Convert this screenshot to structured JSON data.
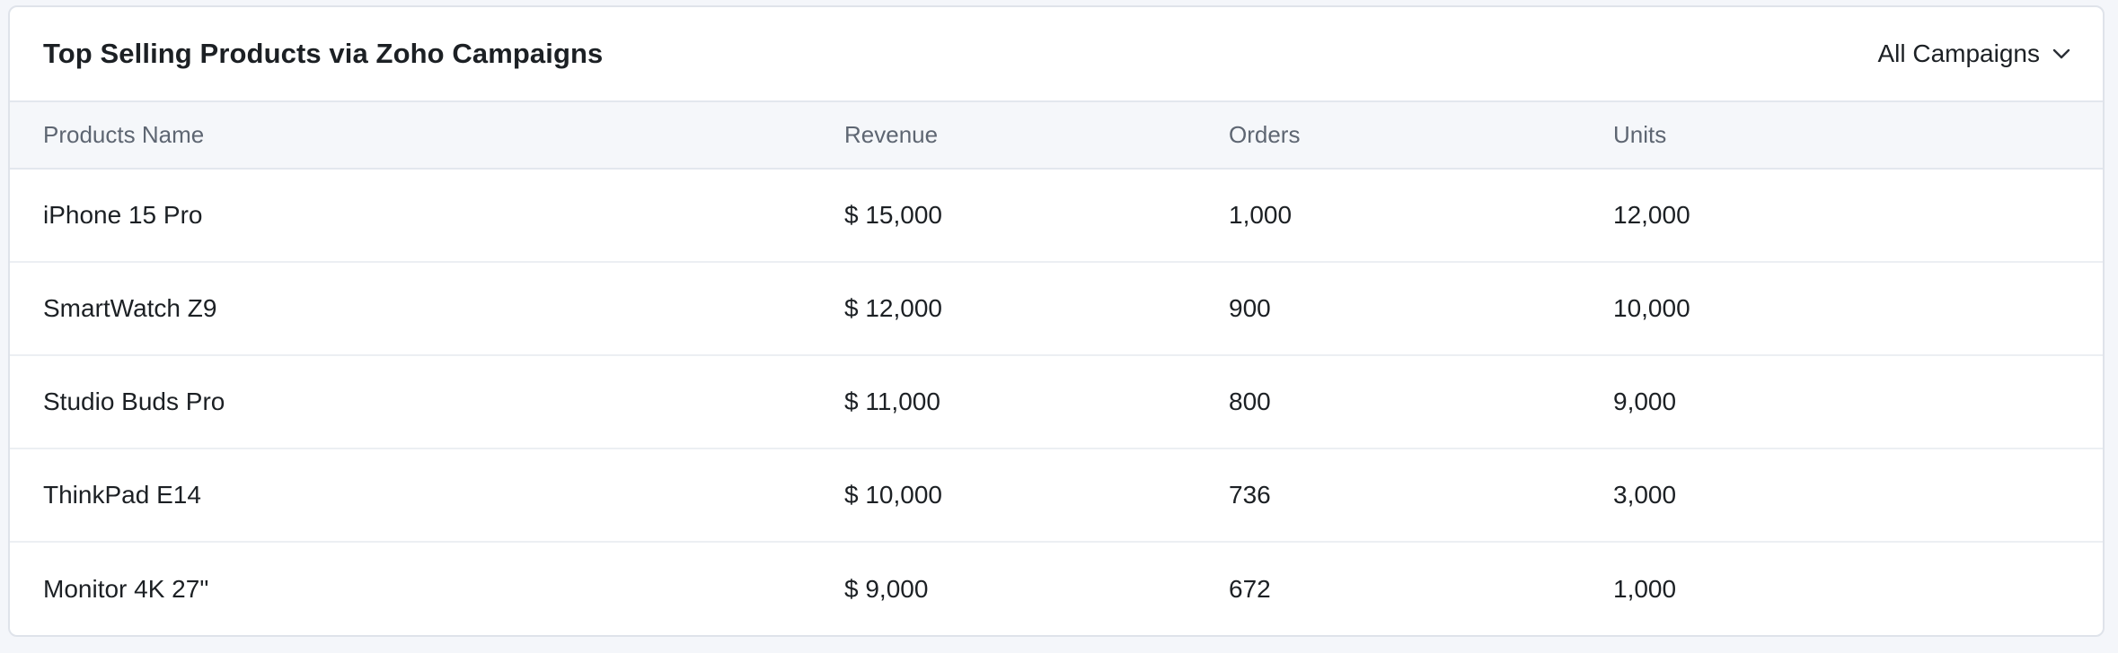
{
  "widget": {
    "title": "Top Selling Products via Zoho Campaigns",
    "filter": {
      "selected": "All Campaigns",
      "icon": "chevron-down-icon"
    }
  },
  "table": {
    "columns": [
      "Products Name",
      "Revenue",
      "Orders",
      "Units"
    ],
    "rows": [
      [
        "iPhone 15 Pro",
        "$ 15,000",
        "1,000",
        "12,000"
      ],
      [
        "SmartWatch Z9",
        "$ 12,000",
        "900",
        "10,000"
      ],
      [
        "Studio Buds Pro",
        "$ 11,000",
        "800",
        "9,000"
      ],
      [
        "ThinkPad E14",
        "$ 10,000",
        "736",
        "3,000"
      ],
      [
        "Monitor 4K 27\"",
        "$ 9,000",
        "672",
        "1,000"
      ]
    ]
  },
  "colors": {
    "page_background": "#f4f6fa",
    "card_background": "#ffffff",
    "header_row_background": "#f5f7fa",
    "text_primary": "#1c2024",
    "text_secondary": "#5e6672",
    "border": "#e3e7ee"
  }
}
